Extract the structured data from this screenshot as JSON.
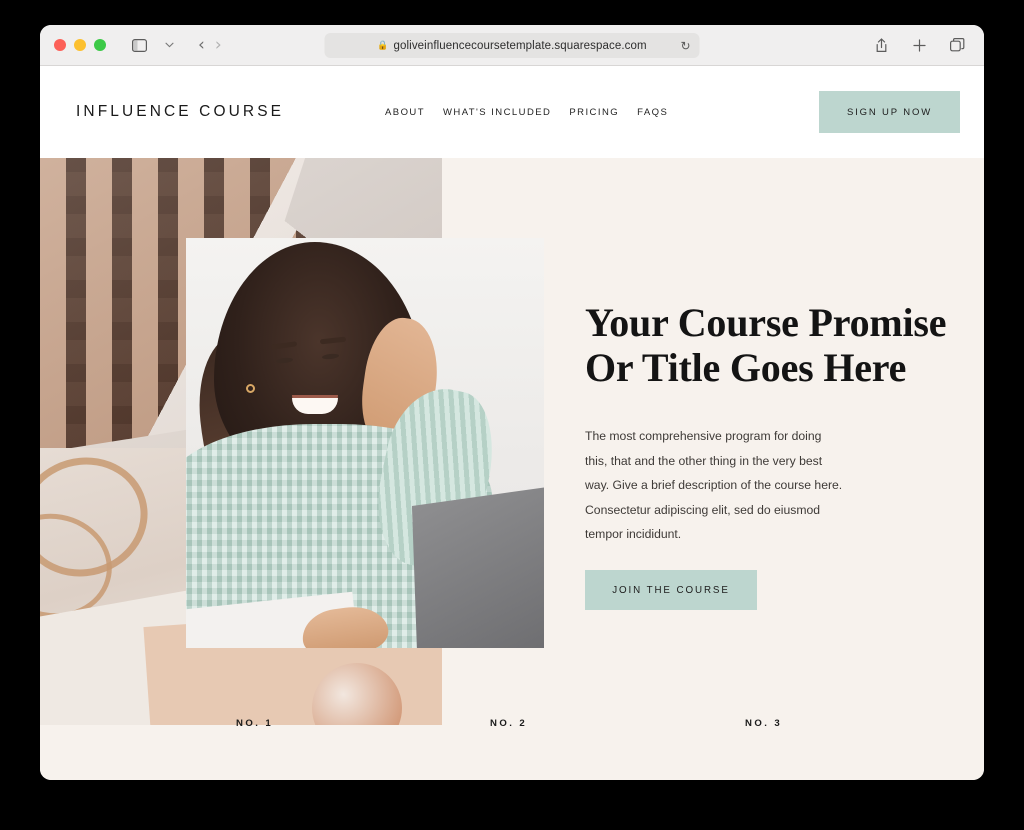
{
  "browser": {
    "url": "goliveinfluencecoursetemplate.squarespace.com",
    "lock_icon": "lock-icon",
    "reload_icon": "reload-icon",
    "sidebar_icon": "sidebar-toggle-icon",
    "dropdown_icon": "chevron-down-icon",
    "back_icon": "‹",
    "forward_icon": "›",
    "share_icon": "share-icon",
    "new_tab_icon": "plus-icon",
    "tabs_icon": "tabs-overview-icon"
  },
  "site": {
    "logo": "INFLUENCE COURSE",
    "nav": [
      {
        "label": "ABOUT"
      },
      {
        "label": "WHAT'S INCLUDED"
      },
      {
        "label": "PRICING"
      },
      {
        "label": "FAQS"
      }
    ],
    "signup_label": "SIGN UP NOW",
    "hero": {
      "headline_line1": "Your Course Promise",
      "headline_line2": "Or Title Goes Here",
      "paragraph": "The most comprehensive program for doing this, that and the other thing in the very best way. Give a brief description of the course here. Consectetur adipiscing elit, sed do eiusmod tempor incididunt.",
      "cta_label": "JOIN THE COURSE",
      "images": {
        "collage_top": "woven-basket-texture-photo",
        "collage_bottom": "gold-hoop-earrings-on-paper-photo",
        "portrait": "smiling-woman-in-mint-sweater-at-laptop-photo"
      }
    },
    "numbers": [
      {
        "label": "NO. 1"
      },
      {
        "label": "NO. 2"
      },
      {
        "label": "NO. 3"
      }
    ]
  },
  "colors": {
    "page_background": "#f7f2ed",
    "accent_mint": "#bdd6cf",
    "header_background": "#ffffff",
    "text_dark": "#1a1a1a"
  }
}
